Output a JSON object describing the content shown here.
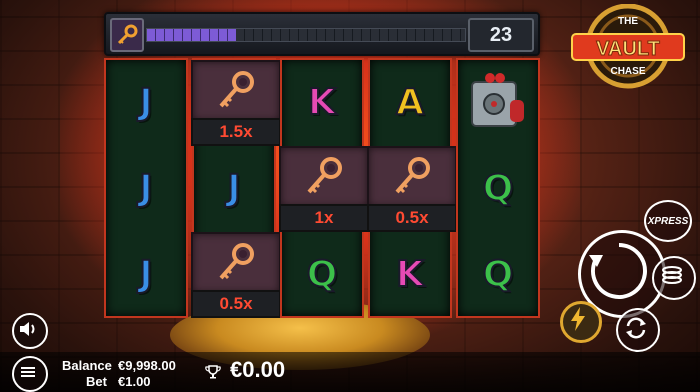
{
  "header": {
    "progress_percent": 28,
    "counter": "23"
  },
  "logo": {
    "line1": "THE",
    "line2": "VAULT",
    "line3": "CHASE"
  },
  "reels": [
    [
      {
        "symbol": "J",
        "color": "#3a8ee6"
      },
      {
        "symbol": "J",
        "color": "#3a8ee6"
      },
      {
        "symbol": "J",
        "color": "#3a8ee6"
      }
    ],
    [
      {
        "symbol": "key",
        "multiplier": "1.5x"
      },
      {
        "symbol": "J",
        "color": "#3a8ee6"
      },
      {
        "symbol": "key",
        "multiplier": "0.5x"
      }
    ],
    [
      {
        "symbol": "K",
        "color": "#e64ab4"
      },
      {
        "symbol": "key",
        "multiplier": "1x"
      },
      {
        "symbol": "Q",
        "color": "#3cc04a"
      }
    ],
    [
      {
        "symbol": "A",
        "color": "#f0c020"
      },
      {
        "symbol": "key",
        "multiplier": "0.5x"
      },
      {
        "symbol": "K",
        "color": "#e64ab4"
      }
    ],
    [
      {
        "symbol": "safe"
      },
      {
        "symbol": "Q",
        "color": "#3cc04a"
      },
      {
        "symbol": "Q",
        "color": "#3cc04a"
      }
    ]
  ],
  "controls": {
    "xpress_label": "XPRESS"
  },
  "footer": {
    "balance_label": "Balance",
    "balance_value": "€9,998.00",
    "bet_label": "Bet",
    "bet_value": "€1.00",
    "win_value": "€0.00"
  },
  "icons": [
    "key-icon",
    "sound-icon",
    "menu-icon",
    "trophy-icon",
    "spin-icon",
    "autoplay-icon",
    "turbo-icon",
    "refresh-icon",
    "safe-icon"
  ]
}
